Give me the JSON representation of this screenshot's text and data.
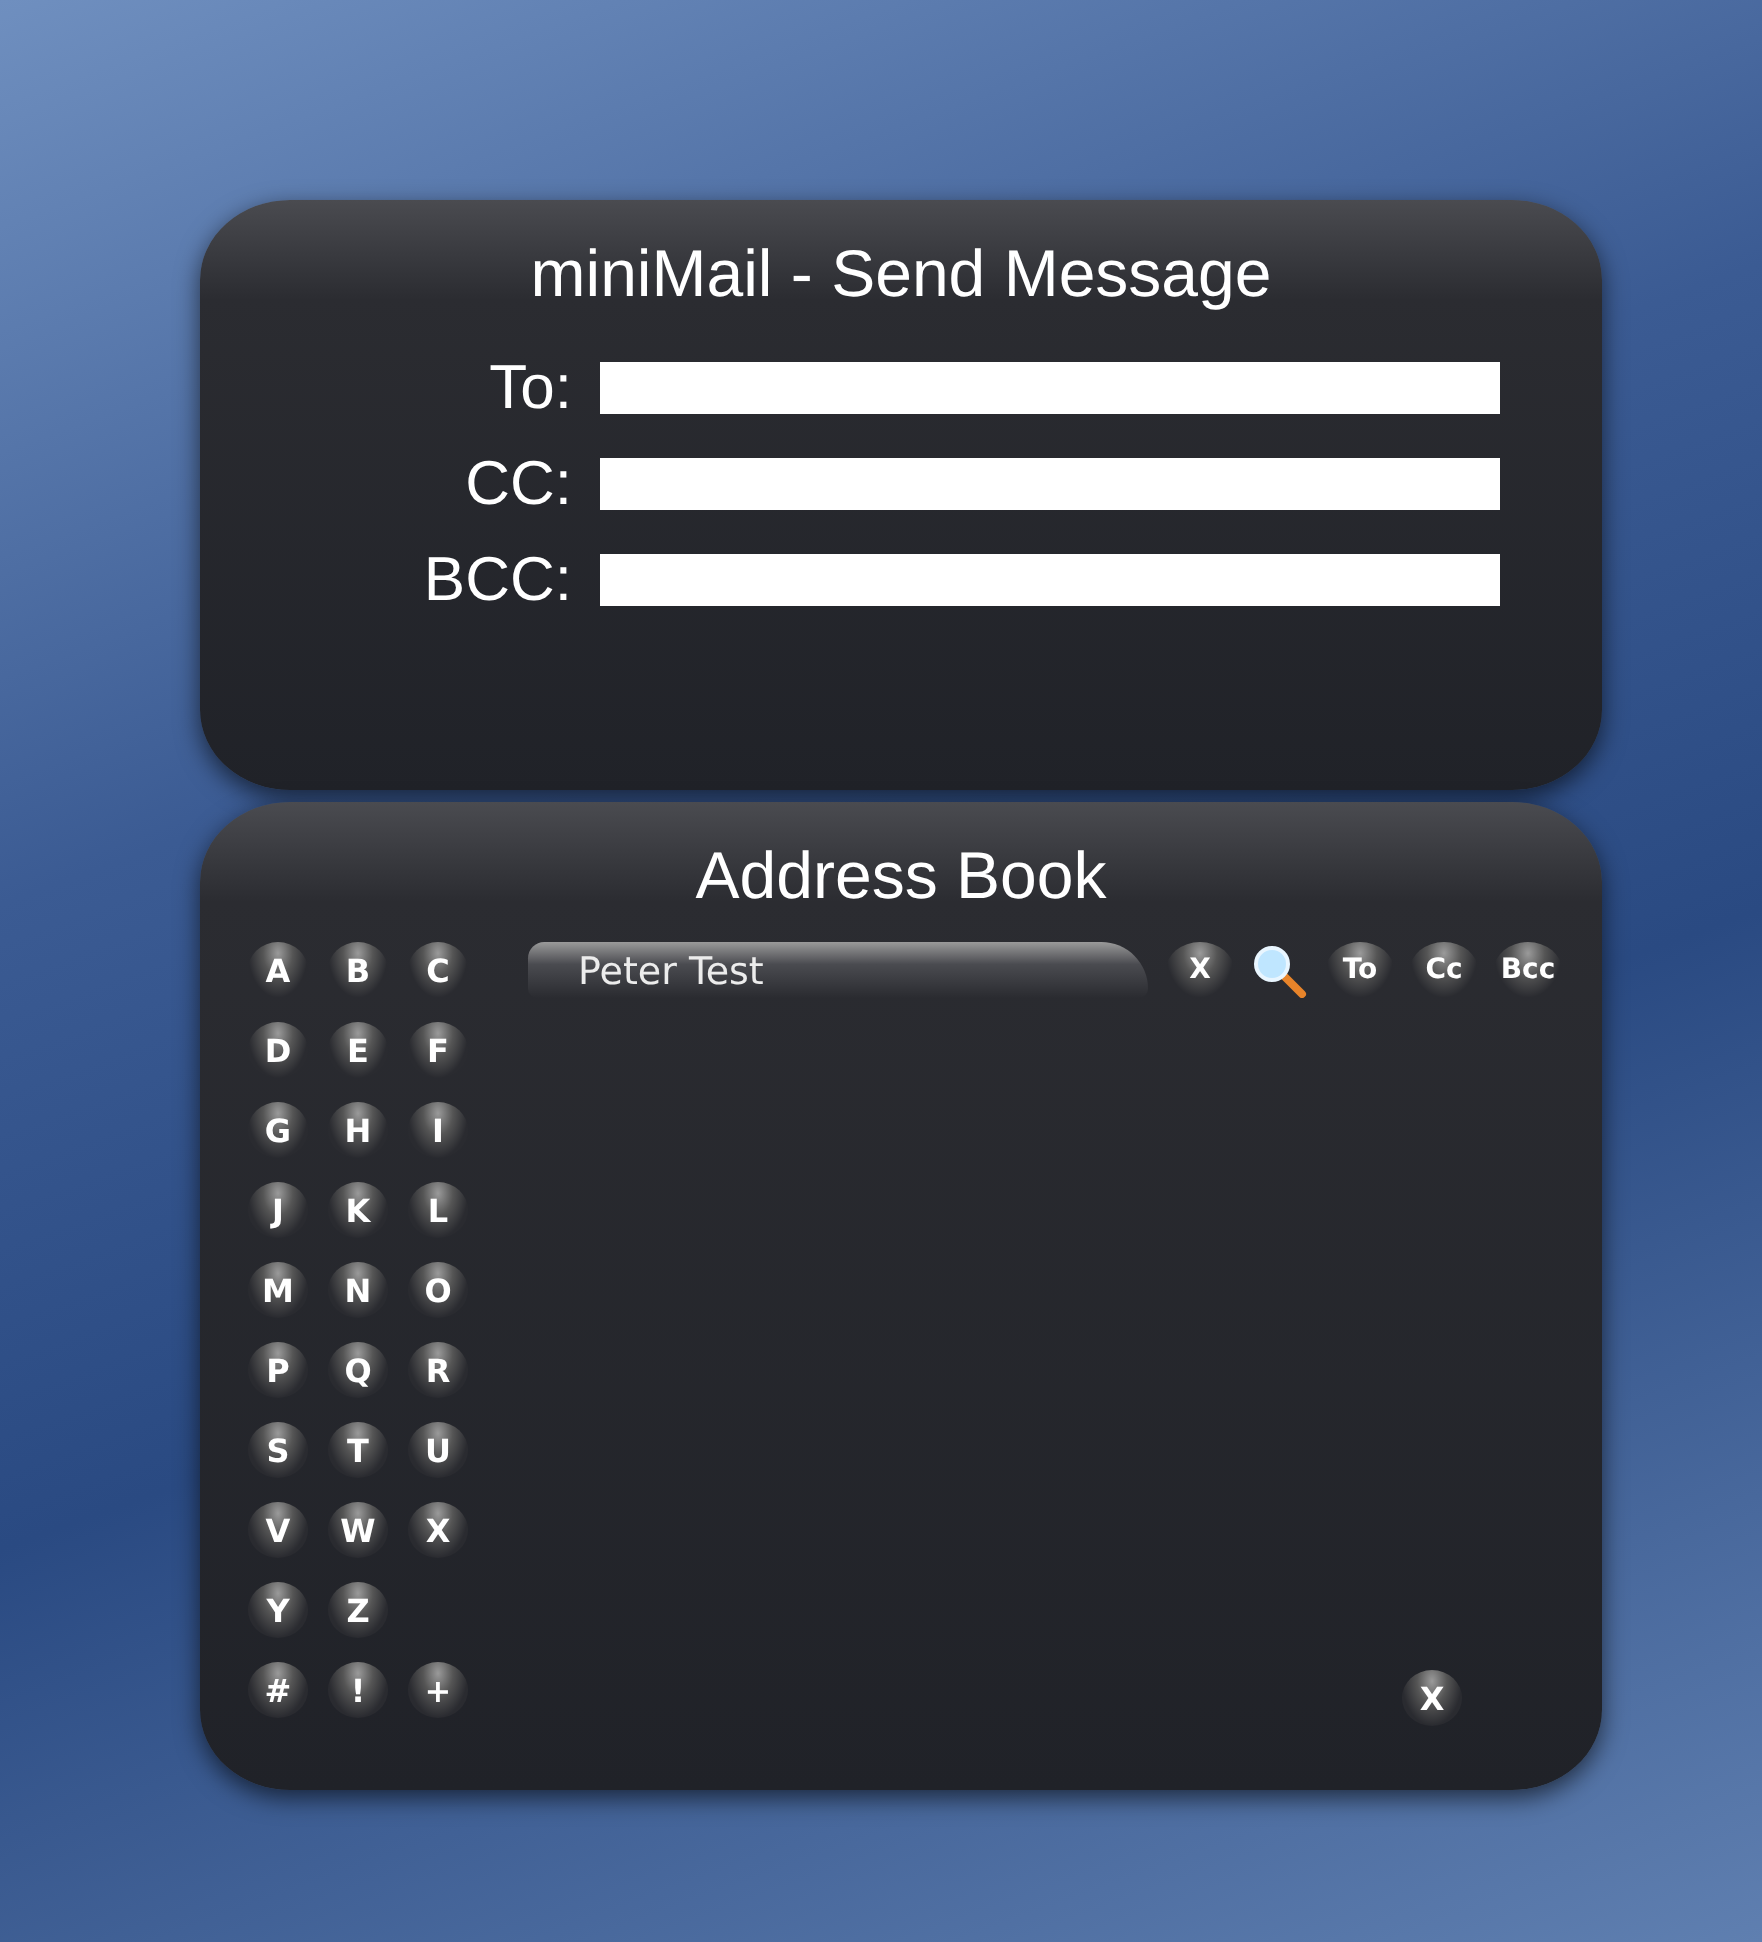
{
  "compose": {
    "title": "miniMail - Send Message",
    "fields": [
      {
        "label": "To:"
      },
      {
        "label": "CC:"
      },
      {
        "label": "BCC:"
      }
    ]
  },
  "address_book": {
    "title": "Address Book",
    "letter_rows": [
      [
        "A",
        "B",
        "C"
      ],
      [
        "D",
        "E",
        "F"
      ],
      [
        "G",
        "H",
        "I"
      ],
      [
        "J",
        "K",
        "L"
      ],
      [
        "M",
        "N",
        "O"
      ],
      [
        "P",
        "Q",
        "R"
      ],
      [
        "S",
        "T",
        "U"
      ],
      [
        "V",
        "W",
        "X"
      ],
      [
        "Y",
        "Z"
      ],
      [
        "#",
        "!",
        "+"
      ]
    ],
    "contacts": [
      {
        "name": "Peter Test"
      }
    ],
    "actions": [
      {
        "kind": "text",
        "label": "X"
      },
      {
        "kind": "search"
      },
      {
        "kind": "text",
        "label": "To"
      },
      {
        "kind": "text",
        "label": "Cc"
      },
      {
        "kind": "text",
        "label": "Bcc"
      }
    ],
    "close_label": "X"
  }
}
